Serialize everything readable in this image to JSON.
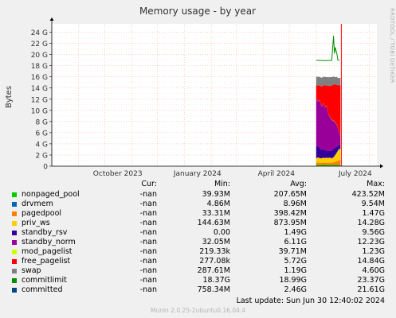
{
  "chart_data": {
    "type": "area",
    "title": "Memory usage - by year",
    "ylabel": "Bytes",
    "ylim": [
      0,
      25.5
    ],
    "y_ticks": [
      "0",
      "2 G",
      "4 G",
      "6 G",
      "8 G",
      "10 G",
      "12 G",
      "14 G",
      "16 G",
      "18 G",
      "20 G",
      "22 G",
      "24 G"
    ],
    "x_ticks": [
      "October 2023",
      "January 2024",
      "April 2024",
      "July 2024"
    ],
    "grid": true,
    "x_dates": [
      "2024-06-01",
      "2024-06-03",
      "2024-06-05",
      "2024-06-07",
      "2024-06-09",
      "2024-06-11",
      "2024-06-13",
      "2024-06-15",
      "2024-06-17",
      "2024-06-19",
      "2024-06-21",
      "2024-06-23",
      "2024-06-25",
      "2024-06-27",
      "2024-06-29"
    ],
    "stack_order": [
      "nonpaged_pool",
      "drvmem",
      "pagedpool",
      "priv_ws",
      "standby_rsv",
      "standby_norm",
      "mod_pagelist",
      "free_pagelist",
      "swap"
    ],
    "series": [
      {
        "name": "nonpaged_pool",
        "color": "#00cc00",
        "values": [
          0.2,
          0.21,
          0.2,
          0.2,
          0.21,
          0.21,
          0.2,
          0.2,
          0.21,
          0.2,
          0.2,
          0.21,
          0.2,
          0.21,
          0.2
        ]
      },
      {
        "name": "drvmem",
        "color": "#0066b3",
        "values": [
          0.01,
          0.01,
          0.01,
          0.01,
          0.01,
          0.01,
          0.01,
          0.01,
          0.01,
          0.01,
          0.01,
          0.01,
          0.01,
          0.01,
          0.01
        ]
      },
      {
        "name": "pagedpool",
        "color": "#ff8000",
        "values": [
          0.4,
          0.45,
          0.4,
          0.38,
          0.42,
          0.4,
          0.4,
          0.42,
          0.4,
          0.4,
          0.5,
          0.6,
          0.7,
          0.8,
          0.9
        ]
      },
      {
        "name": "priv_ws",
        "color": "#ffcc00",
        "values": [
          0.8,
          0.9,
          0.85,
          0.8,
          0.9,
          0.85,
          0.9,
          0.85,
          0.9,
          0.8,
          0.9,
          1.2,
          1.6,
          2.0,
          2.0
        ]
      },
      {
        "name": "standby_rsv",
        "color": "#330099",
        "values": [
          2.2,
          2.0,
          1.8,
          1.5,
          1.5,
          1.4,
          1.3,
          1.3,
          1.2,
          1.4,
          1.5,
          1.3,
          1.0,
          0.8,
          0.7
        ]
      },
      {
        "name": "standby_norm",
        "color": "#990099",
        "values": [
          8.5,
          8.0,
          8.6,
          7.8,
          8.2,
          7.6,
          8.0,
          6.5,
          6.0,
          5.5,
          5.0,
          4.5,
          3.8,
          2.5,
          1.6
        ]
      },
      {
        "name": "mod_pagelist",
        "color": "#ccff00",
        "values": [
          0.04,
          0.04,
          0.04,
          0.04,
          0.04,
          0.04,
          0.04,
          0.04,
          0.04,
          0.04,
          0.04,
          0.04,
          0.04,
          0.04,
          0.04
        ]
      },
      {
        "name": "free_pagelist",
        "color": "#ff0000",
        "values": [
          2.4,
          2.8,
          2.6,
          3.5,
          3.2,
          4.0,
          3.6,
          5.1,
          5.6,
          6.1,
          6.5,
          6.8,
          7.2,
          8.1,
          9.1
        ]
      },
      {
        "name": "swap",
        "color": "#808080",
        "values": [
          1.5,
          1.6,
          1.5,
          1.6,
          1.5,
          1.5,
          1.5,
          1.5,
          1.6,
          1.5,
          1.4,
          1.3,
          1.4,
          1.3,
          1.3
        ]
      }
    ],
    "lines": [
      {
        "name": "commitlimit",
        "color": "#008f00",
        "x_dates": [
          "2024-06-01",
          "2024-06-10",
          "2024-06-19",
          "2024-06-21",
          "2024-06-22",
          "2024-06-23",
          "2024-06-25",
          "2024-06-26",
          "2024-06-28"
        ],
        "values": [
          18.99,
          18.9,
          18.95,
          23.37,
          20.2,
          21.3,
          20.0,
          19.0,
          19.0
        ]
      }
    ],
    "vrule": {
      "color": "#ff0000"
    }
  },
  "axis": {
    "side_label": "RRDTOOL / TOBI OETIKER"
  },
  "legend": {
    "headers": {
      "cur": "Cur:",
      "min": "Min:",
      "avg": "Avg:",
      "max": "Max:"
    },
    "rows": [
      {
        "name": "nonpaged_pool",
        "color": "#00cc00",
        "cur": "-nan",
        "min": "39.93M",
        "avg": "207.65M",
        "max": "423.52M"
      },
      {
        "name": "drvmem",
        "color": "#0066b3",
        "cur": "-nan",
        "min": "4.86M",
        "avg": "8.96M",
        "max": "9.54M"
      },
      {
        "name": "pagedpool",
        "color": "#ff8000",
        "cur": "-nan",
        "min": "33.31M",
        "avg": "398.42M",
        "max": "1.47G"
      },
      {
        "name": "priv_ws",
        "color": "#ffcc00",
        "cur": "-nan",
        "min": "144.63M",
        "avg": "873.95M",
        "max": "14.28G"
      },
      {
        "name": "standby_rsv",
        "color": "#330099",
        "cur": "-nan",
        "min": "0.00",
        "avg": "1.49G",
        "max": "9.56G"
      },
      {
        "name": "standby_norm",
        "color": "#990099",
        "cur": "-nan",
        "min": "32.05M",
        "avg": "6.11G",
        "max": "12.23G"
      },
      {
        "name": "mod_pagelist",
        "color": "#ccff00",
        "cur": "-nan",
        "min": "219.33k",
        "avg": "39.71M",
        "max": "1.23G"
      },
      {
        "name": "free_pagelist",
        "color": "#ff0000",
        "cur": "-nan",
        "min": "277.08k",
        "avg": "5.72G",
        "max": "14.84G"
      },
      {
        "name": "swap",
        "color": "#808080",
        "cur": "-nan",
        "min": "287.61M",
        "avg": "1.19G",
        "max": "4.60G"
      },
      {
        "name": "commitlimit",
        "color": "#008f00",
        "cur": "-nan",
        "min": "18.37G",
        "avg": "18.99G",
        "max": "23.37G"
      },
      {
        "name": "committed",
        "color": "#00457c",
        "cur": "-nan",
        "min": "758.34M",
        "avg": "2.46G",
        "max": "21.61G"
      }
    ]
  },
  "last_update": "Last update:  Sun Jun 30 12:40:02 2024",
  "footer": "Munin 2.0.25-2ubuntu0.16.04.4"
}
